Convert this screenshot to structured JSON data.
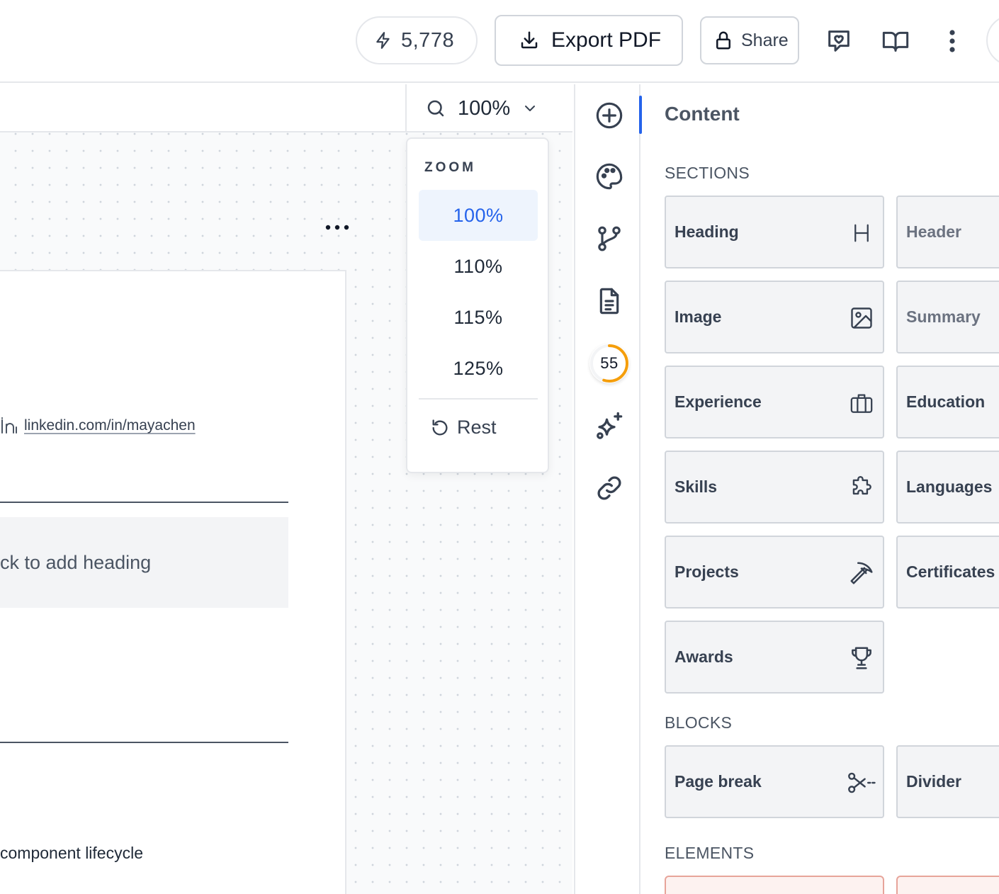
{
  "topbar": {
    "credits": "5,778",
    "export_label": "Export PDF",
    "share_label": "Share"
  },
  "canvas": {
    "zoom_value": "100%",
    "linkedin_url": "linkedin.com/in/mayachen",
    "heading_placeholder": "ck to add heading",
    "body_text": "component lifecycle"
  },
  "zoom_menu": {
    "label": "ZOOM",
    "options": [
      "100%",
      "110%",
      "115%",
      "125%"
    ],
    "selected": "100%",
    "reset_label": "Rest"
  },
  "rail": {
    "score": "55",
    "score_fraction": 0.55,
    "score_color": "#f59e0b",
    "active_color": "#2563eb",
    "icons": [
      "add-circle-icon",
      "palette-icon",
      "branch-icon",
      "document-icon",
      "score-ring",
      "sparkles-icon",
      "link-icon"
    ]
  },
  "panel": {
    "title": "Content",
    "sections_label": "SECTIONS",
    "sections": [
      {
        "label": "Heading",
        "icon": "heading-h-icon"
      },
      {
        "label": "Header"
      },
      {
        "label": "Image",
        "icon": "image-icon"
      },
      {
        "label": "Summary"
      },
      {
        "label": "Experience",
        "icon": "briefcase-icon"
      },
      {
        "label": "Education"
      },
      {
        "label": "Skills",
        "icon": "puzzle-icon"
      },
      {
        "label": "Languages"
      },
      {
        "label": "Projects",
        "icon": "pickaxe-icon"
      },
      {
        "label": "Certificates"
      },
      {
        "label": "Awards",
        "icon": "trophy-icon"
      }
    ],
    "blocks_label": "BLOCKS",
    "blocks": [
      {
        "label": "Page break",
        "icon": "scissors-icon"
      },
      {
        "label": "Divider"
      }
    ],
    "elements_label": "ELEMENTS"
  }
}
